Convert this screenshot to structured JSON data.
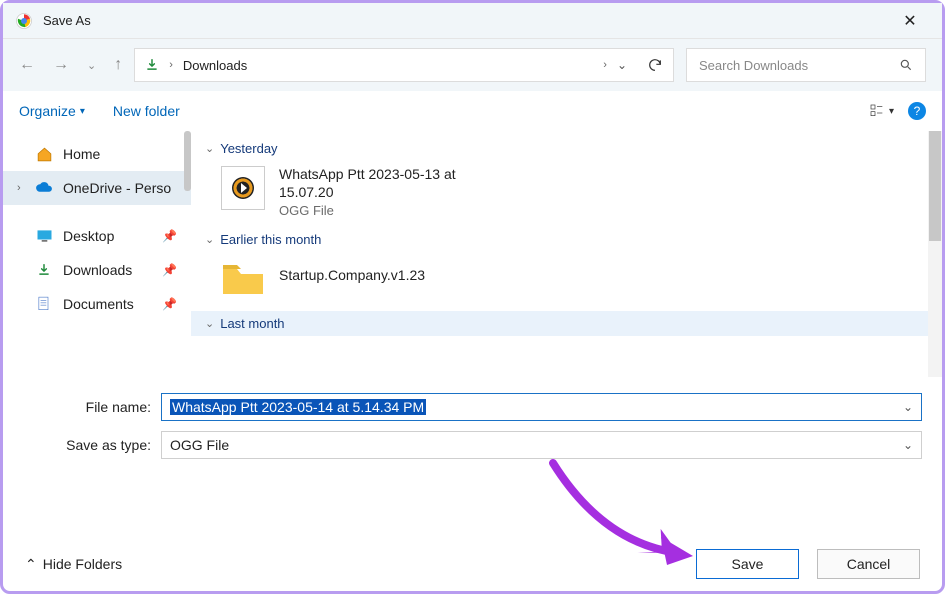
{
  "window": {
    "title": "Save As"
  },
  "nav": {
    "location": "Downloads",
    "search_placeholder": "Search Downloads"
  },
  "toolbar": {
    "organize": "Organize",
    "new_folder": "New folder"
  },
  "sidebar": {
    "home": "Home",
    "onedrive": "OneDrive - Perso",
    "desktop": "Desktop",
    "downloads": "Downloads",
    "documents": "Documents"
  },
  "groups": {
    "yesterday": "Yesterday",
    "earlier_month": "Earlier this month",
    "last_month": "Last month"
  },
  "files": {
    "ogg_name": "WhatsApp Ptt 2023-05-13 at 15.07.20",
    "ogg_type": "OGG File",
    "folder_name": "Startup.Company.v1.23"
  },
  "form": {
    "filename_label": "File name:",
    "filename_value": "WhatsApp Ptt 2023-05-14 at 5.14.34 PM",
    "savetype_label": "Save as type:",
    "savetype_value": "OGG File"
  },
  "footer": {
    "hide_folders": "Hide Folders",
    "save": "Save",
    "cancel": "Cancel"
  }
}
